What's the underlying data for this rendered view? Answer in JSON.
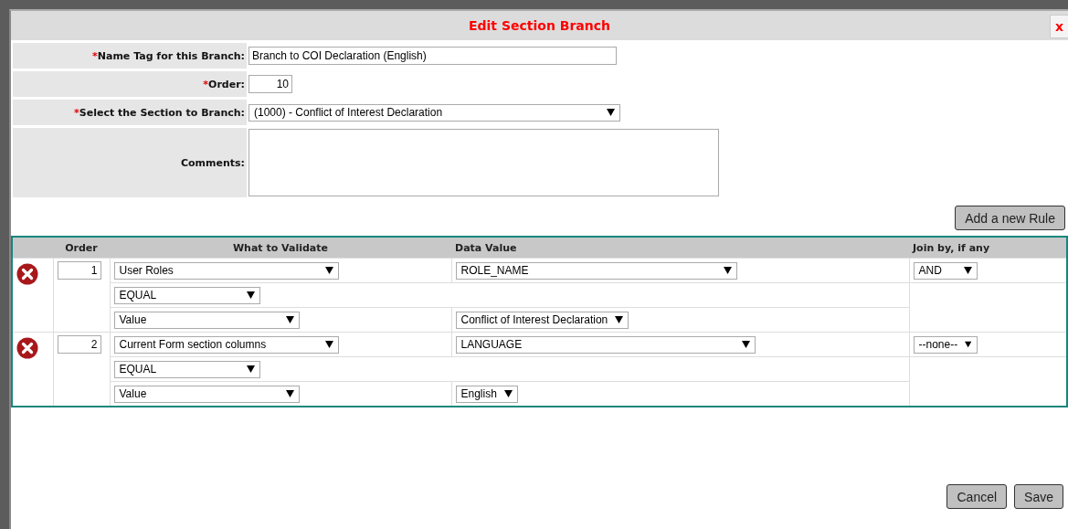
{
  "dialog": {
    "title": "Edit Section Branch",
    "close": "x"
  },
  "form": [
    {
      "kind": "text",
      "required": true,
      "label": "Name Tag for this Branch:",
      "value": "Branch to COI Declaration (English)"
    },
    {
      "kind": "number",
      "required": true,
      "label": "Order:",
      "value": "10"
    },
    {
      "kind": "select",
      "required": true,
      "label": "Select the Section to Branch:",
      "value": "(1000) - Conflict of Interest Declaration"
    },
    {
      "kind": "textarea",
      "required": false,
      "label": "Comments:"
    }
  ],
  "required_mark": "*",
  "add_rule_button": "Add a new Rule",
  "rules_table": {
    "columns": [
      "Order",
      "What to Validate",
      "Data Value",
      "Join by, if any"
    ],
    "rules": [
      {
        "order": "1",
        "field": "User Roles",
        "data_value": "ROLE_NAME",
        "join": "AND",
        "operator": "EQUAL",
        "compare_type": "Value",
        "compare_value": "Conflict of Interest Declaration"
      },
      {
        "order": "2",
        "field": "Current Form section columns",
        "data_value": "LANGUAGE",
        "join": "--none--",
        "operator": "EQUAL",
        "compare_type": "Value",
        "compare_value": "English"
      }
    ]
  },
  "buttons": [
    "Cancel",
    "Save"
  ]
}
